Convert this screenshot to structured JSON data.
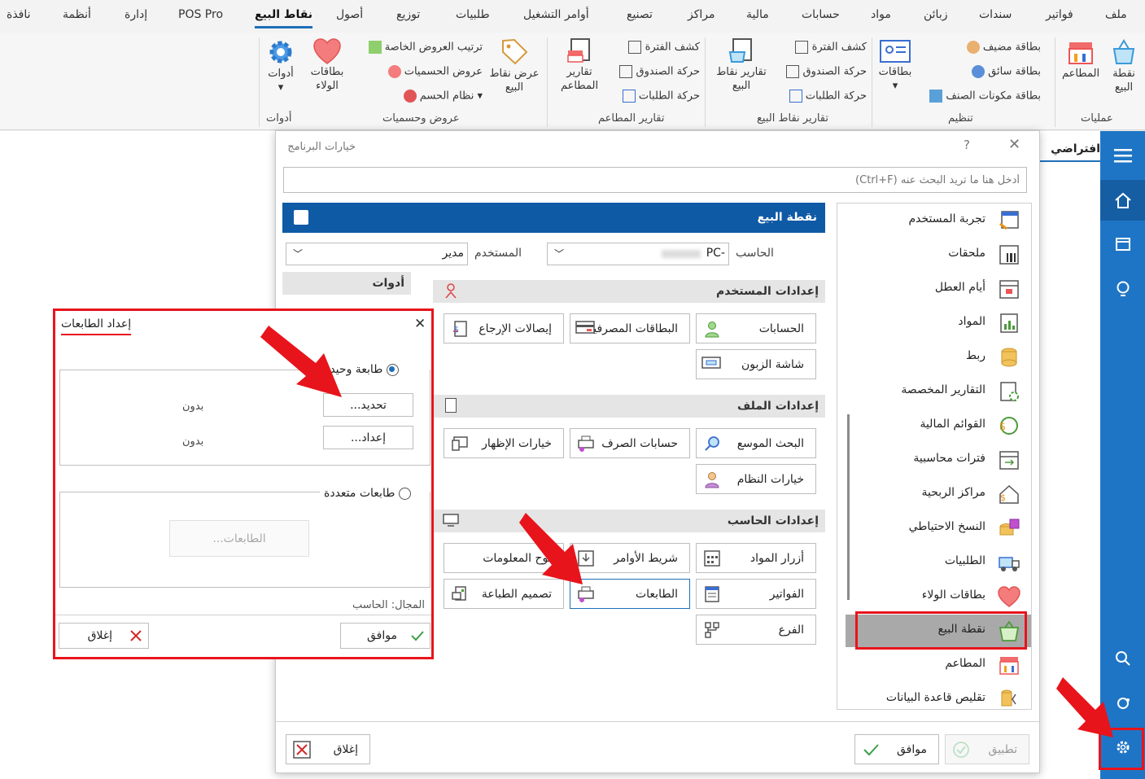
{
  "menu_tabs": [
    "ملف",
    "فواتير",
    "سندات",
    "زبائن",
    "مواد",
    "حسابات",
    "مالية",
    "مراكز",
    "تصنيع",
    "أوامر التشغيل",
    "طلبيات",
    "توزيع",
    "أصول",
    "نقاط البيع",
    "POS Pro",
    "إدارة",
    "أنظمة",
    "نافذة"
  ],
  "active_tab": "نقاط البيع",
  "ribbon": {
    "ops_group": "عمليات",
    "pos_basket": "نقطة البيع",
    "restaurants": "المطاعم",
    "org_group": "تنظيم",
    "cards": "بطاقات",
    "guest_card": "بطاقة مضيف",
    "driver_card": "بطاقة سائق",
    "item_components_card": "بطاقة مكونات الصنف",
    "pos_reports_group": "تقارير نقاط البيع",
    "pos_reports": "تقارير نقاط البيع",
    "period_statement": "كشف الفترة",
    "cash_movement": "حركة الصندوق",
    "orders_movement": "حركة الطلبات",
    "rest_reports_group": "تقارير المطاعم",
    "rest_reports": "تقارير المطاعم",
    "period_statement2": "كشف الفترة",
    "cash_movement2": "حركة الصندوق",
    "orders_movement2": "حركة الطلبات",
    "offers_group": "عروض وحسميات",
    "display_pos": "عرض نقاط البيع",
    "loyalty_cards": "بطاقات الولاء",
    "special_offers_order": "ترتيب العروض الخاصة",
    "discount_offers": "عروض الحسميات",
    "discount_system": "نظام الحسم",
    "tools_group": "أدوات",
    "tools": "أدوات"
  },
  "main": {
    "tab_label": "افتراضي"
  },
  "options_dialog": {
    "title": "خيارات البرنامج",
    "help": "?",
    "search_placeholder": "أدخل هنا ما تريد البحث عنه (Ctrl+F)",
    "section_title": "نقطة البيع",
    "computer_label": "الحاسب",
    "computer_value": "PC-",
    "user_label": "المستخدم",
    "user_value": "مدير",
    "tools_header": "أدوات",
    "user_settings": "إعدادات المستخدم",
    "file_settings": "إعدادات الملف",
    "computer_settings": "إعدادات الحاسب",
    "buttons": {
      "accounts": "الحسابات",
      "bank_cards": "البطاقات المصرفية",
      "return_receipts": "إيصالات الإرجاع",
      "customer_screen": "شاشة الزبون",
      "extended_search": "البحث الموسع",
      "exchange_accounts": "حسابات الصرف",
      "display_options": "خيارات الإظهار",
      "system_options": "خيارات النظام",
      "item_buttons": "أزرار المواد",
      "command_bar": "شريط الأوامر",
      "info_board": "لوح المعلومات",
      "invoices": "الفواتير",
      "printers": "الطابعات",
      "print_design": "تصميم الطباعة",
      "branch": "الفرع"
    },
    "nav": [
      "تجربة المستخدم",
      "ملحقات",
      "أيام العطل",
      "المواد",
      "ربط",
      "التقارير المخصصة",
      "القوائم المالية",
      "فترات محاسبية",
      "مراكز الربحية",
      "النسخ الاحتياطي",
      "الطلبيات",
      "بطاقات الولاء",
      "نقطة البيع",
      "المطاعم",
      "تقليص قاعدة البيانات"
    ],
    "selected_nav": "نقطة البيع",
    "ok": "موافق",
    "apply": "تطبيق",
    "close": "إغلاق"
  },
  "printer_dialog": {
    "title": "إعداد الطابعات",
    "single_printer": "طابعة وحيدة",
    "select_btn": "تحديد...",
    "setup_btn": "إعداد...",
    "none1": "بدون",
    "none2": "بدون",
    "multi_printer": "طابعات متعددة",
    "printers_btn": "الطابعات...",
    "scope": "المجال: الحاسب",
    "ok": "موافق",
    "close": "إغلاق"
  },
  "colors": {
    "accent": "#1f75c5",
    "header_blue": "#0f5aa5",
    "highlight_red": "#e8141b",
    "selected_gray": "#a9a9a9"
  }
}
